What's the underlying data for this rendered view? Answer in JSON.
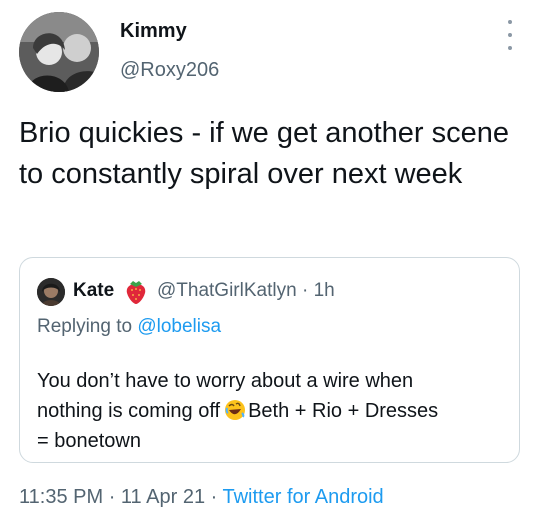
{
  "author": {
    "display_name": "Kimmy",
    "handle": "@Roxy206"
  },
  "tweet": {
    "text": "Brio quickies - if we get another scene to constantly spiral over next week"
  },
  "quoted": {
    "display_name": "Kate",
    "name_emoji": "strawberry-icon",
    "handle": "@ThatGirlKatlyn",
    "separator": "·",
    "time": "1h",
    "reply_prefix": "Replying to",
    "reply_to": "@lobelisa",
    "text_line1": "You don’t have to worry about a wire when",
    "text_line2_a": "nothing is coming off",
    "inline_emoji": "rolling-on-floor-laughing-icon",
    "text_line2_b": "Beth + Rio + Dresses",
    "text_line3": "= bonetown"
  },
  "meta": {
    "time": "11:35 PM",
    "sep1": "·",
    "date": "11 Apr 21",
    "sep2": "·",
    "source": "Twitter for Android"
  },
  "colors": {
    "text_primary": "#0f1419",
    "text_secondary": "#536471",
    "link": "#1d9bf0",
    "border": "#cfd9de"
  }
}
